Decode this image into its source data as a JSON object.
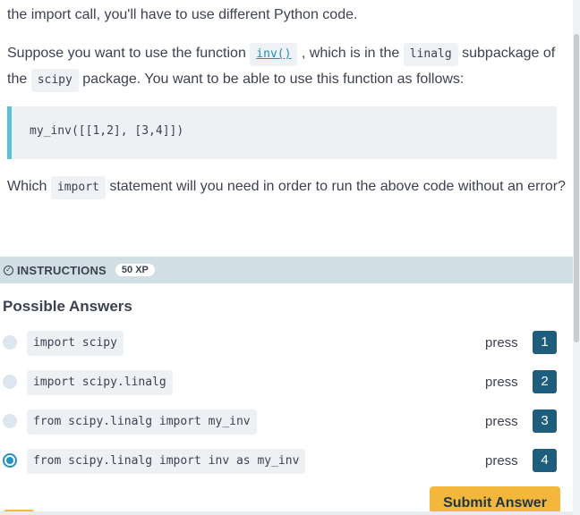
{
  "lesson": {
    "intro_line": "the import call, you'll have to use different Python code.",
    "para1_part1": "Suppose you want to use the function ",
    "para1_func": "inv()",
    "para1_part2": " , which is in the ",
    "para1_sub": "linalg",
    "para1_part3": " subpackage of the ",
    "para1_pkg": "scipy",
    "para1_part4": " package. You want to be able to use this function as follows:",
    "code_example": "my_inv([[1,2], [3,4]])",
    "question_part1": "Which ",
    "question_keyword": "import",
    "question_part2": " statement will you need in order to run the above code without an error?"
  },
  "instructions": {
    "icon": "check-circle-icon",
    "label": "INSTRUCTIONS",
    "xp": "50 XP"
  },
  "answers": {
    "title": "Possible Answers",
    "press_label": "press",
    "options": [
      {
        "code": "import scipy",
        "key": "1",
        "selected": false
      },
      {
        "code": "import scipy.linalg",
        "key": "2",
        "selected": false
      },
      {
        "code": "from scipy.linalg import my_inv",
        "key": "3",
        "selected": false
      },
      {
        "code": "from scipy.linalg import inv as my_inv",
        "key": "4",
        "selected": true
      }
    ],
    "submit_label": "Submit Answer"
  },
  "colors": {
    "accent": "#2392c4",
    "key_badge": "#1d5e7c",
    "submit": "#f5b73b",
    "instructions_bar": "#d1dee4"
  }
}
